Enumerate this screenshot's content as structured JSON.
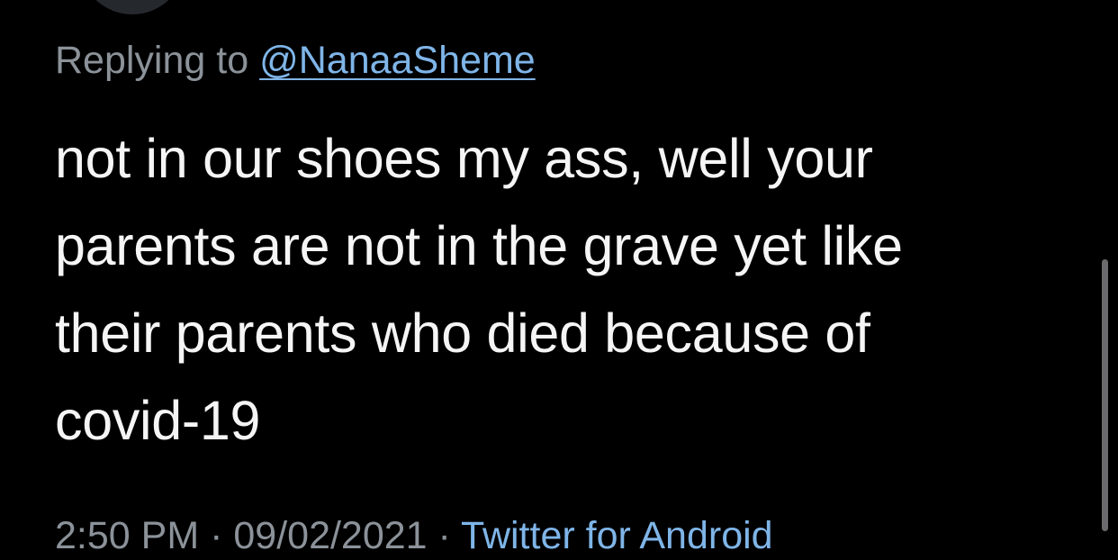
{
  "reply": {
    "prefix": "Replying to",
    "handle": "@NanaaSheme"
  },
  "tweet": {
    "lines": [
      "not in our shoes my ass, well your",
      "parents are not in the grave yet like",
      "their parents who died because of",
      "covid-19"
    ]
  },
  "meta": {
    "time": "2:50 PM",
    "separator": "·",
    "date": "09/02/2021",
    "source_separator": "·",
    "source": "Twitter for Android"
  },
  "colors": {
    "background": "#000000",
    "text": "#f5f5f5",
    "secondary_text": "#8b9299",
    "link": "#7fb5e8"
  }
}
